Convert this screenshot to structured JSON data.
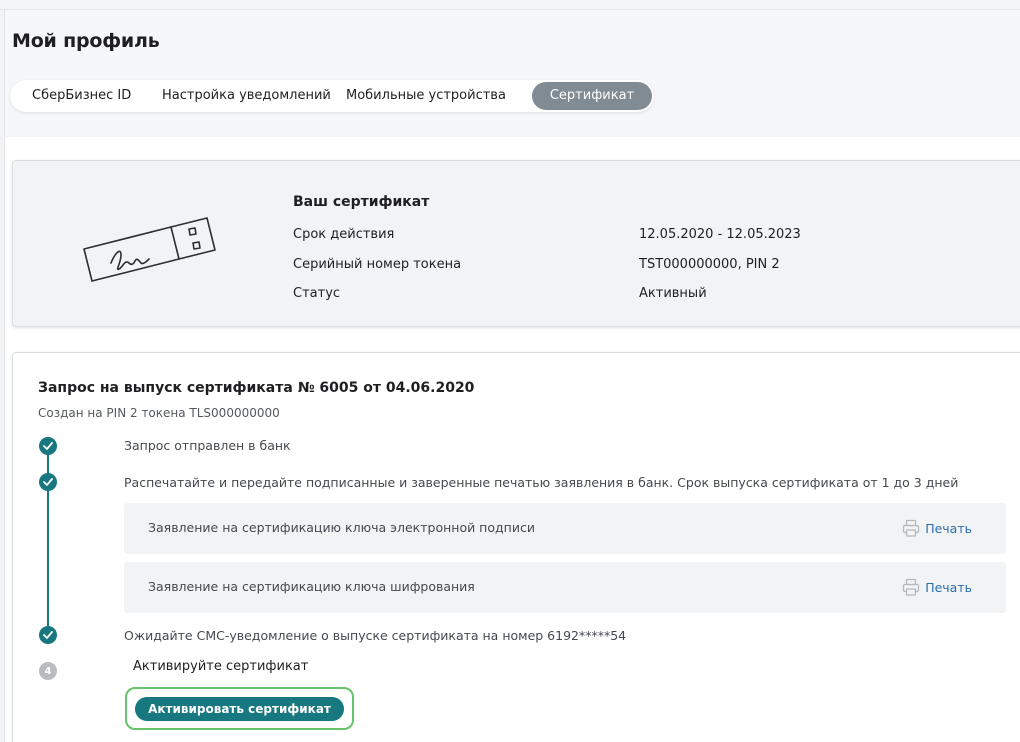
{
  "page": {
    "title": "Мой профиль"
  },
  "tabs": [
    {
      "label": "СберБизнес ID",
      "active": false
    },
    {
      "label": "Настройка уведомлений",
      "active": false
    },
    {
      "label": "Мобильные устройства",
      "active": false
    },
    {
      "label": "Сертификат",
      "active": true
    }
  ],
  "certificate": {
    "title": "Ваш сертификат",
    "icon": "usb-token-icon",
    "rows": [
      {
        "label": "Срок действия",
        "value": "12.05.2020 - 12.05.2023"
      },
      {
        "label": "Серийный номер токена",
        "value": "TST000000000, PIN 2"
      },
      {
        "label": "Статус",
        "value": "Активный"
      }
    ]
  },
  "request": {
    "title": "Запрос на выпуск сертификата № 6005 от 04.06.2020",
    "subtitle": "Создан на PIN 2 токена TLS000000000",
    "steps": [
      {
        "text": "Запрос отправлен в банк",
        "done": true
      },
      {
        "text": "Распечатайте и передайте подписанные и заверенные печатью заявления в банк. Срок выпуска сертификата от 1 до 3 дней",
        "done": true
      },
      {
        "text": "Ожидайте СМС-уведомление о выпуске сертификата на номер 6192*****54",
        "done": true
      },
      {
        "text": "Активируйте сертификат",
        "done": false,
        "number": "4"
      }
    ],
    "documents": [
      {
        "label": "Заявление на сертификацию ключа электронной подписи",
        "action": "Печать"
      },
      {
        "label": "Заявление на сертификацию ключа шифрования",
        "action": "Печать"
      }
    ],
    "activate_button": "Активировать сертификат"
  },
  "colors": {
    "accent": "#17787f",
    "active_tab": "#818b93",
    "link": "#2a6fb0",
    "highlight": "#63c46a"
  }
}
